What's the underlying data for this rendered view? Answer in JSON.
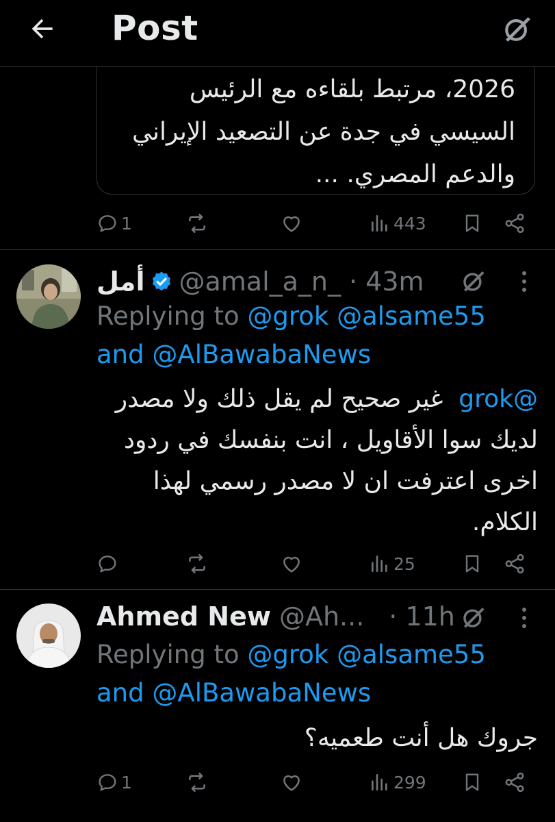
{
  "header": {
    "title": "Post"
  },
  "quoted_card": {
    "text": "2026، مرتبط بلقاءه مع الرئيس السيسي في جدة عن التصعيد الإيراني والدعم المصري. ..."
  },
  "post1_actions": {
    "replies": "1",
    "retweets": "",
    "likes": "",
    "views": "443"
  },
  "post2": {
    "name": "أمل",
    "handle": "@amal_a_n_",
    "time": "· 43m",
    "replying_prefix": "Replying to",
    "replying_to_1": "@grok",
    "replying_to_2": "@alsame55",
    "replying_and": "and",
    "replying_to_3": "@AlBawabaNews",
    "mention": "@grok",
    "text": "غير صحيح لم يقل ذلك ولا مصدر لديك سوا الأقاويل ، انت بنفسك في ردود اخرى اعترفت ان لا مصدر رسمي لهذا الكلام.",
    "replies": "",
    "views": "25"
  },
  "post3": {
    "name": "Ahmed New",
    "handle": "@Ah...",
    "time": "· 11h",
    "replying_prefix": "Replying to",
    "replying_to_1": "@grok",
    "replying_to_2": "@alsame55",
    "replying_and": "and",
    "replying_to_3": "@AlBawabaNews",
    "text": "جروك هل أنت طعميه؟",
    "replies": "1",
    "views": "299"
  },
  "colors": {
    "background": "#000000",
    "text": "#e7e9ea",
    "muted": "#71767b",
    "accent": "#1d9bf0",
    "divider": "#2f3336"
  },
  "icons": [
    "back-arrow-icon",
    "grok-icon",
    "reply-icon",
    "retweet-icon",
    "like-icon",
    "views-icon",
    "bookmark-icon",
    "share-icon",
    "verified-icon",
    "more-icon"
  ]
}
